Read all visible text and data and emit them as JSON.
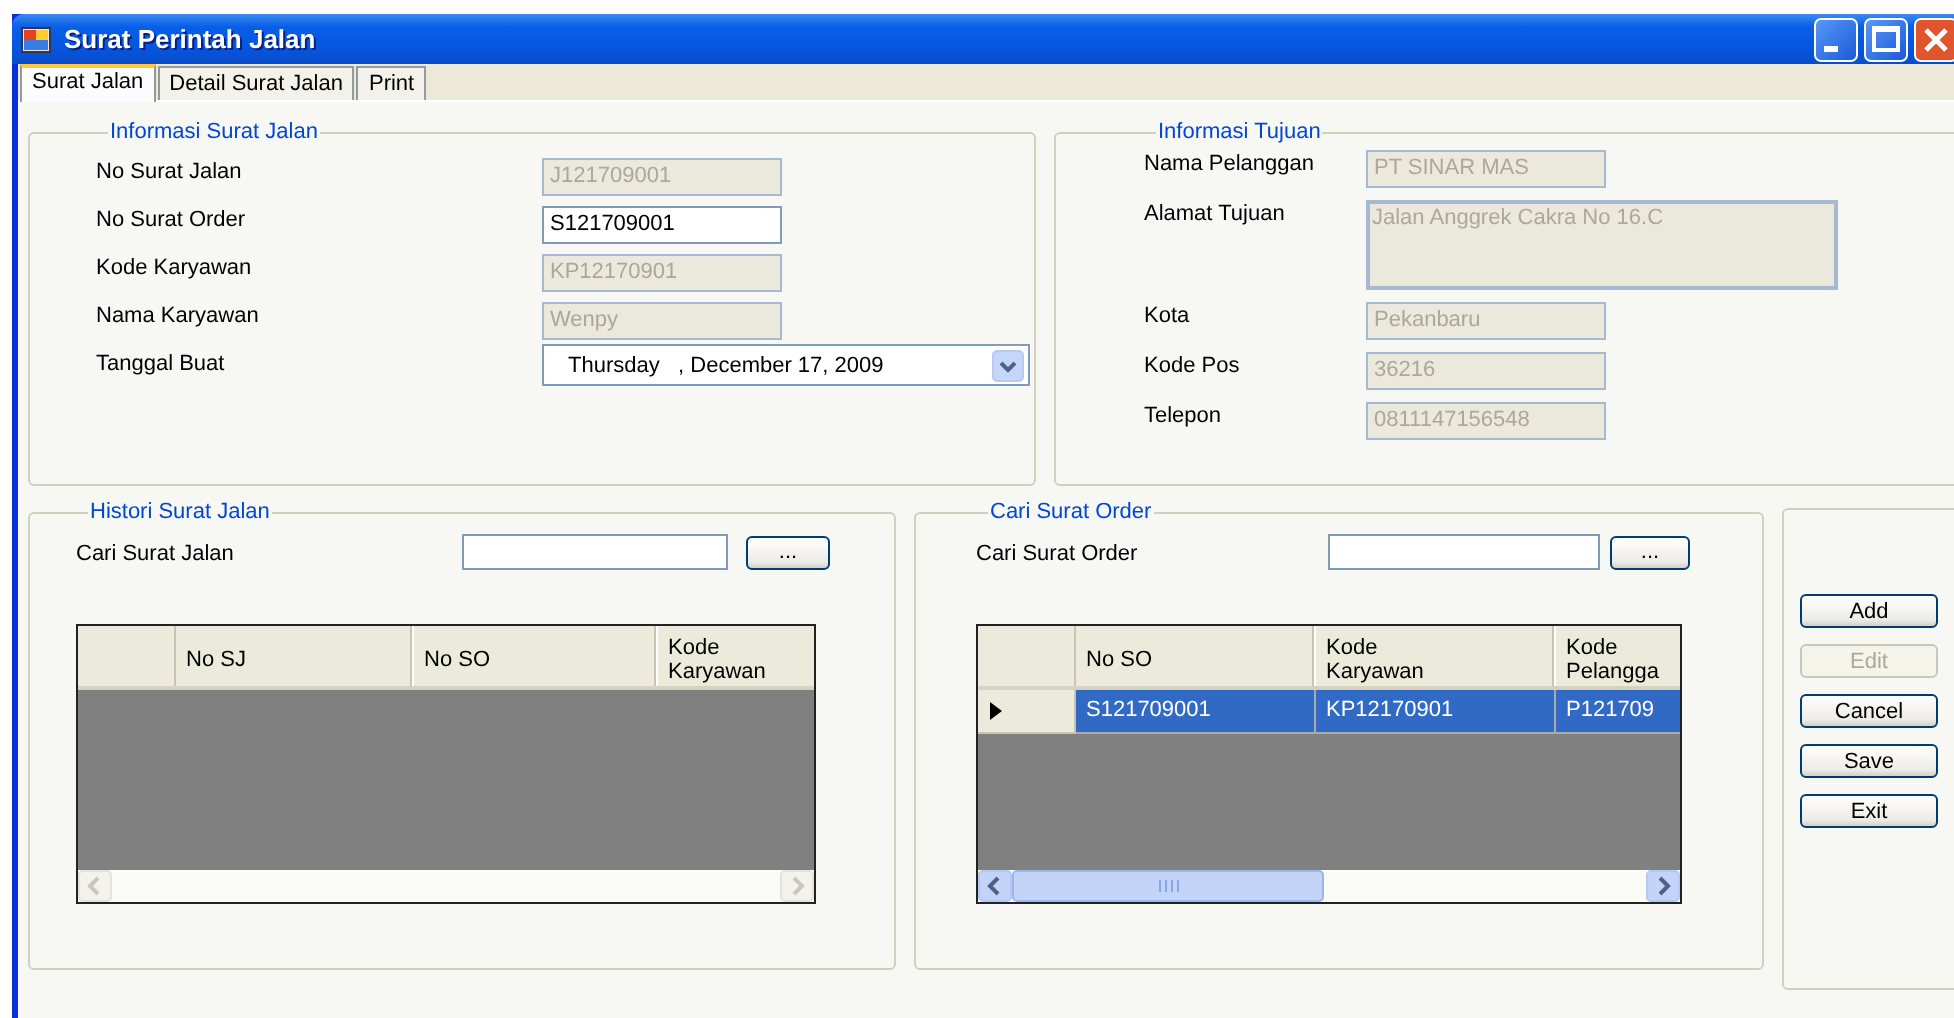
{
  "window": {
    "title": "Surat Perintah Jalan"
  },
  "tabs": [
    {
      "label": "Surat Jalan",
      "selected": true
    },
    {
      "label": "Detail Surat Jalan",
      "selected": false
    },
    {
      "label": "Print",
      "selected": false
    }
  ],
  "informasi_surat_jalan": {
    "title": "Informasi Surat Jalan",
    "fields": [
      {
        "label": "No Surat Jalan",
        "value": "J121709001",
        "kind": "text",
        "disabled": true
      },
      {
        "label": "No Surat Order",
        "value": "S121709001",
        "kind": "text",
        "disabled": false
      },
      {
        "label": "Kode Karyawan",
        "value": "KP12170901",
        "kind": "text",
        "disabled": true
      },
      {
        "label": "Nama Karyawan",
        "value": "Wenpy",
        "kind": "text",
        "disabled": true
      },
      {
        "label": "Tanggal Buat",
        "value": "Thursday   , December 17, 2009",
        "kind": "date",
        "disabled": false
      }
    ]
  },
  "informasi_tujuan": {
    "title": "Informasi Tujuan",
    "fields": [
      {
        "label": "Nama Pelanggan",
        "value": "PT SINAR MAS",
        "kind": "text",
        "disabled": true
      },
      {
        "label": "Alamat Tujuan",
        "value": "Jalan Anggrek Cakra No 16.C",
        "kind": "multiline",
        "disabled": true
      },
      {
        "label": "Kota",
        "value": "Pekanbaru",
        "kind": "text",
        "disabled": true
      },
      {
        "label": "Kode Pos",
        "value": "36216",
        "kind": "text",
        "disabled": true
      },
      {
        "label": "Telepon",
        "value": "0811147156548",
        "kind": "text",
        "disabled": true
      }
    ]
  },
  "histori_surat_jalan": {
    "title": "Histori Surat Jalan",
    "search_label": "Cari Surat Jalan",
    "browse_button": "...",
    "table": {
      "columns": [
        "No SJ",
        "No SO",
        "Kode Karyawan"
      ]
    }
  },
  "cari_surat_order": {
    "title": "Cari Surat Order",
    "search_label": "Cari Surat Order",
    "browse_button": "...",
    "table": {
      "columns": [
        "No SO",
        "Kode Karyawan",
        "Kode Pelangga"
      ],
      "rows": [
        {
          "cells": [
            "S121709001",
            "KP12170901",
            "P121709"
          ],
          "selected": true
        }
      ]
    }
  },
  "buttons": [
    {
      "label": "Add",
      "disabled": false
    },
    {
      "label": "Edit",
      "disabled": true
    },
    {
      "label": "Cancel",
      "disabled": false
    },
    {
      "label": "Save",
      "disabled": false
    },
    {
      "label": "Exit",
      "disabled": false
    }
  ]
}
